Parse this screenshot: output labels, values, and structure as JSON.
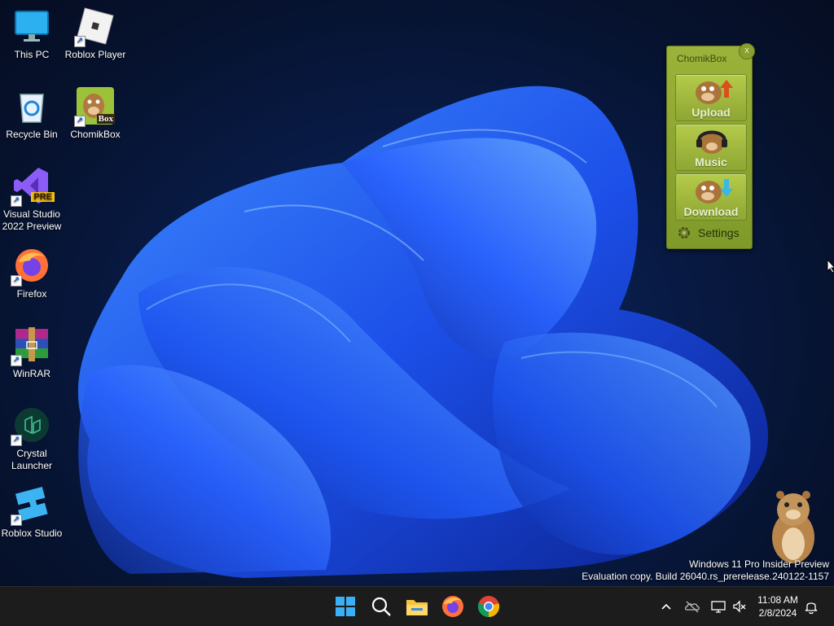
{
  "desktop": {
    "icons": [
      {
        "label": "This PC",
        "icon": "monitor-icon"
      },
      {
        "label": "Roblox Player",
        "icon": "roblox-player-icon"
      },
      {
        "label": "Recycle Bin",
        "icon": "recycle-bin-icon"
      },
      {
        "label": "ChomikBox",
        "icon": "chomikbox-icon",
        "badge": "Box"
      },
      {
        "label": "Visual Studio 2022 Preview",
        "icon": "visual-studio-icon",
        "badge": "PRE"
      },
      {
        "label": "Firefox",
        "icon": "firefox-icon"
      },
      {
        "label": "WinRAR",
        "icon": "winrar-icon"
      },
      {
        "label": "Crystal Launcher",
        "icon": "crystal-launcher-icon"
      },
      {
        "label": "Roblox Studio",
        "icon": "roblox-studio-icon"
      }
    ]
  },
  "chomikbox": {
    "title": "ChomikBox",
    "close": "x",
    "buttons": [
      {
        "label": "Upload",
        "icon": "upload-arrow-icon"
      },
      {
        "label": "Music",
        "icon": "headphones-icon"
      },
      {
        "label": "Download",
        "icon": "download-arrow-icon"
      }
    ],
    "settings": "Settings"
  },
  "watermark": {
    "line1": "Windows 11 Pro Insider Preview",
    "line2": "Evaluation copy. Build 26040.rs_prerelease.240122-1157"
  },
  "taskbar": {
    "apps": [
      "start-icon",
      "search-icon",
      "file-explorer-icon",
      "firefox-icon",
      "chrome-icon"
    ],
    "tray": [
      "chevron-up-icon",
      "onedrive-offline-icon",
      "network-icon",
      "volume-muted-icon"
    ],
    "time": "11:08 AM",
    "date": "2/8/2024"
  },
  "colors": {
    "accent": "#1f5fff",
    "widget_green": "#8ea633",
    "taskbar": "#1c1c1c"
  }
}
